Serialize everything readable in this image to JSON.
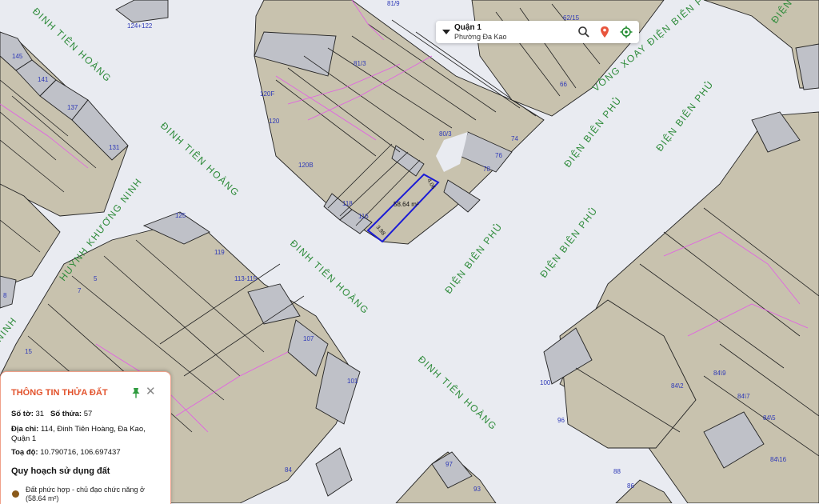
{
  "search": {
    "district": "Quận 1",
    "ward": "Phường Đa Kao"
  },
  "streets": [
    {
      "label": "ĐINH TIÊN HOÀNG"
    },
    {
      "label": "ĐINH TIÊN HOÀNG"
    },
    {
      "label": "ĐINH TIÊN HOÀNG"
    },
    {
      "label": "ĐINH TIÊN HOÀNG"
    },
    {
      "label": "ĐIỆN BIÊN PHỦ"
    },
    {
      "label": "ĐIỆN BIÊN PHỦ"
    },
    {
      "label": "ĐIỆN BIÊN PHỦ"
    },
    {
      "label": "ĐIỆN BIÊN PHỦ"
    },
    {
      "label": "ĐIỆN BIÊN PHỦ"
    },
    {
      "label": "VÕNG XOAY ĐIỆN BIÊN PHỦ"
    },
    {
      "label": "HUỲNH KHƯƠNG NINH"
    },
    {
      "label": "NINH"
    },
    {
      "label": "ĐIỆN BIÊN PHỦ"
    }
  ],
  "parcel_numbers": [
    "124+122",
    "145",
    "141",
    "137",
    "131",
    "125",
    "119",
    "113-115",
    "107",
    "101",
    "84",
    "81/9",
    "81/3",
    "62/15",
    "66",
    "120F",
    "120",
    "120B",
    "118",
    "116",
    "80/3",
    "74",
    "76",
    "78",
    "7",
    "5",
    "8",
    "15",
    "97",
    "93",
    "100",
    "96",
    "88",
    "86",
    "84\\2",
    "84\\9",
    "84\\7",
    "84\\5",
    "84\\16"
  ],
  "selected_parcel": {
    "area": "58.64 m²",
    "edge_a": "4.06",
    "edge_b": "3.98"
  },
  "info_panel": {
    "title": "THÔNG TIN THỬA ĐẤT",
    "sheet_label": "Số tờ:",
    "sheet_value": "31",
    "parcel_label": "Số thửa:",
    "parcel_value": "57",
    "address_label": "Địa chỉ:",
    "address_value": "114, Đinh Tiên Hoàng, Đa Kao, Quận 1",
    "coord_label": "Toạ độ:",
    "coord_value": "10.790716, 106.697437",
    "planning_title": "Quy hoạch sử dụng đất",
    "land_use": "Đất phức hợp - chủ đạo chức năng ở (58.64 m²)",
    "land_use_color": "#8a5a1a"
  },
  "colors": {
    "title": "#e2532d",
    "street": "#2e8b3a",
    "number": "#2f3ab8",
    "parcel": "#c8c2ae",
    "selected": "#1b1bd6"
  }
}
